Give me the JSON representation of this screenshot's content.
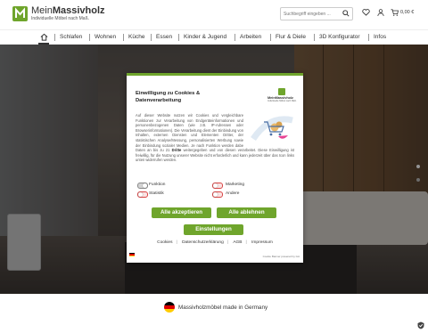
{
  "header": {
    "brand_prefix": "Mein",
    "brand_bold": "Massivholz",
    "tagline": "Individuelle Möbel nach Maß.",
    "search_placeholder": "Suchbegriff eingeben ...",
    "cart_total": "0,00 €",
    "icons": [
      "search-icon",
      "heart-icon",
      "user-icon",
      "cart-icon"
    ]
  },
  "nav": {
    "items": [
      "Schlafen",
      "Wohnen",
      "Küche",
      "Essen",
      "Kinder & Jugend",
      "Arbeiten",
      "Flur & Diele",
      "3D Konfigurator",
      "Infos"
    ]
  },
  "consent": {
    "title": "Einwilligung zu Cookies & Datenverarbeitung",
    "logo_name": "MeinMassivholz",
    "logo_tag": "Individuelle Möbel nach Maß.",
    "body_pre": "Auf dieser Website nutzen wir Cookies und vergleichbare Funktionen zur Verarbeitung von Endgeräteinformationen und personenbezogenen Daten (wie z.B. IP-Adressen oder Browserinformationen). Die Verarbeitung dient der Einbindung von Inhalten, externen Diensten und Elementen Dritter, der statistischen Analyse/Messung, personalisierten Werbung sowie der Einbindung sozialer Medien. Je nach Funktion werden dabe Daten an bis zu 21",
    "body_link": "Dritte",
    "body_post": "weitergegeben und von diesen verarbeitet. Diese Einwilligung ist freiwillig, für die Nutzung unserer Website nicht erforderlich und kann jederzeit über das Icon links unten widerrufen werden.",
    "toggles": [
      {
        "label": "Funktion",
        "state": "on"
      },
      {
        "label": "Marketing",
        "state": "off"
      },
      {
        "label": "Statistik",
        "state": "off"
      },
      {
        "label": "Andere",
        "state": "off"
      }
    ],
    "accept_all": "Alle akzeptieren",
    "reject_all": "Alle ablehnen",
    "settings": "Einstellungen",
    "links": [
      "Cookies",
      "Datenschutzerklärung",
      "AGB",
      "Impressum"
    ],
    "powered": "Cookie Banner powered by GA"
  },
  "footer": {
    "made_in": "Massivholzmöbel made in Germany"
  },
  "colors": {
    "brand_green": "#6fa52c",
    "toggle_off_red": "#d94545"
  }
}
